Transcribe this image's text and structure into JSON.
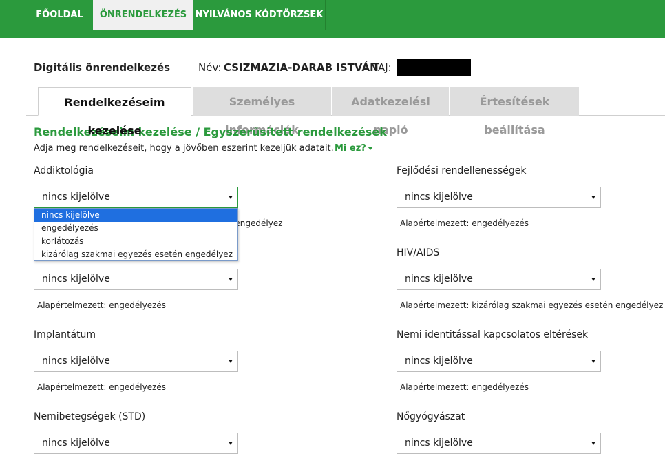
{
  "topnav": {
    "tabs": [
      "FŐOLDAL",
      "ÖNRENDELKEZÉS",
      "NYILVÁNOS KÓDTÖRZSEK"
    ]
  },
  "header": {
    "title": "Digitális önrendelkezés",
    "name_label": "Név:",
    "name_value": "CSIZMAZIA-DARAB ISTVÁN",
    "taj_label": "TAJ:"
  },
  "content_tabs": [
    "Rendelkezéseim kezelése",
    "Személyes információk",
    "Adatkezelési napló",
    "Értesítések beállítása"
  ],
  "section": {
    "heading": "Rendelkezéseim kezelése / Egyszerűsített rendelkezések",
    "description": "Adja meg rendelkezéseit, hogy a jövőben eszerint kezeljük adatait.",
    "help_link": "Mi ez?"
  },
  "dropdown_options": [
    "nincs kijelölve",
    "engedélyezés",
    "korlátozás",
    "kizárólag szakmai egyezés esetén engedélyez"
  ],
  "fields": [
    {
      "label": "Addiktológia",
      "value": "nincs kijelölve",
      "default": "n engedélyez"
    },
    {
      "label": "Fejlődési rendellenességek",
      "value": "nincs kijelölve",
      "default": "Alapértelmezett: engedélyezés"
    },
    {
      "label": "",
      "value": "nincs kijelölve",
      "default": "Alapértelmezett: engedélyezés"
    },
    {
      "label": "HIV/AIDS",
      "value": "nincs kijelölve",
      "default": "Alapértelmezett: kizárólag szakmai egyezés esetén engedélyez"
    },
    {
      "label": "Implantátum",
      "value": "nincs kijelölve",
      "default": "Alapértelmezett: engedélyezés"
    },
    {
      "label": "Nemi identitással kapcsolatos eltérések",
      "value": "nincs kijelölve",
      "default": "Alapértelmezett: engedélyezés"
    },
    {
      "label": "Nemibetegségek (STD)",
      "value": "nincs kijelölve",
      "default": ""
    },
    {
      "label": "Nőgyógyászat",
      "value": "nincs kijelölve",
      "default": ""
    }
  ]
}
